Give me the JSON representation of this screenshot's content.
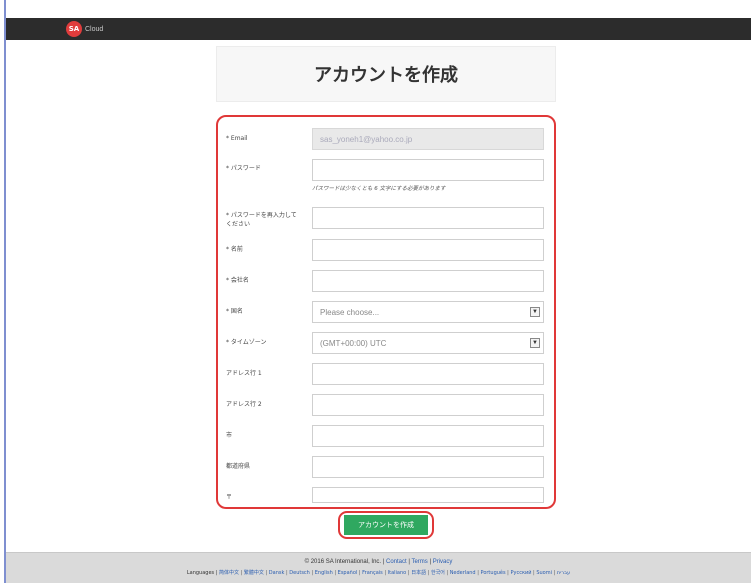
{
  "header": {
    "logo_badge": "SA",
    "logo_text": "Cloud",
    "brand_color": "#e03c3c"
  },
  "page": {
    "title": "アカウントを作成"
  },
  "form": {
    "email": {
      "label": "* Email",
      "value": "sas_yoneh1@yahoo.co.jp"
    },
    "password": {
      "label": "* パスワード",
      "hint": "パスワードは少なくとも 6 文字にする必要があります"
    },
    "password_confirm": {
      "label": "* パスワードを再入力してください"
    },
    "name": {
      "label": "* 名前"
    },
    "company": {
      "label": "* 会社名"
    },
    "country": {
      "label": "* 国名",
      "value": "Please choose..."
    },
    "timezone": {
      "label": "* タイムゾーン",
      "value": "(GMT+00:00) UTC"
    },
    "address1": {
      "label": "アドレス行 1"
    },
    "address2": {
      "label": "アドレス行 2"
    },
    "city": {
      "label": "市"
    },
    "prefecture": {
      "label": "都道府県"
    },
    "postal": {
      "label": "〒"
    }
  },
  "submit": {
    "label": "アカウントを作成",
    "color": "#2fa860"
  },
  "footer": {
    "copyright_prefix": "© 2016 SA International, Inc. | ",
    "contact": "Contact",
    "terms": "Terms",
    "privacy": "Privacy",
    "languages_label": "Languages |",
    "languages": [
      "简体中文",
      "繁體中文",
      "Dansk",
      "Deutsch",
      "English",
      "Español",
      "Français",
      "Italiano",
      "日本語",
      "한국어",
      "Nederland",
      "Português",
      "Русский",
      "Suomi",
      "עברית"
    ]
  }
}
